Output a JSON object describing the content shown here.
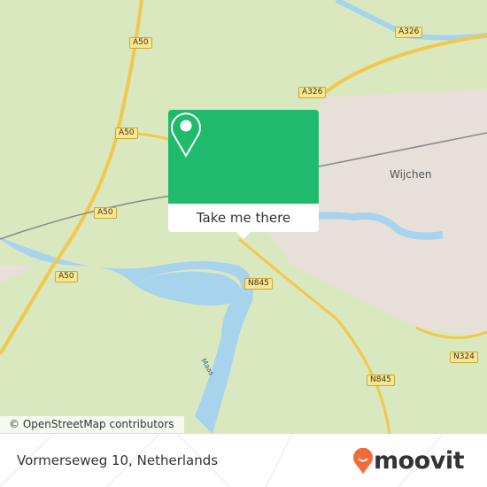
{
  "map": {
    "roads": [
      "A50",
      "A50",
      "A50",
      "A50",
      "A326",
      "A326",
      "N845",
      "N845",
      "N324"
    ],
    "places": {
      "town": "Wijchen",
      "river": "Maas"
    },
    "attribution": "© OpenStreetMap contributors"
  },
  "popup": {
    "icon": "map-pin-icon",
    "button_label": "Take me there",
    "color": "#1fba6b"
  },
  "footer": {
    "address": "Vormerseweg 10, Netherlands",
    "brand": "moovit",
    "brand_color": "#f26b3a"
  }
}
